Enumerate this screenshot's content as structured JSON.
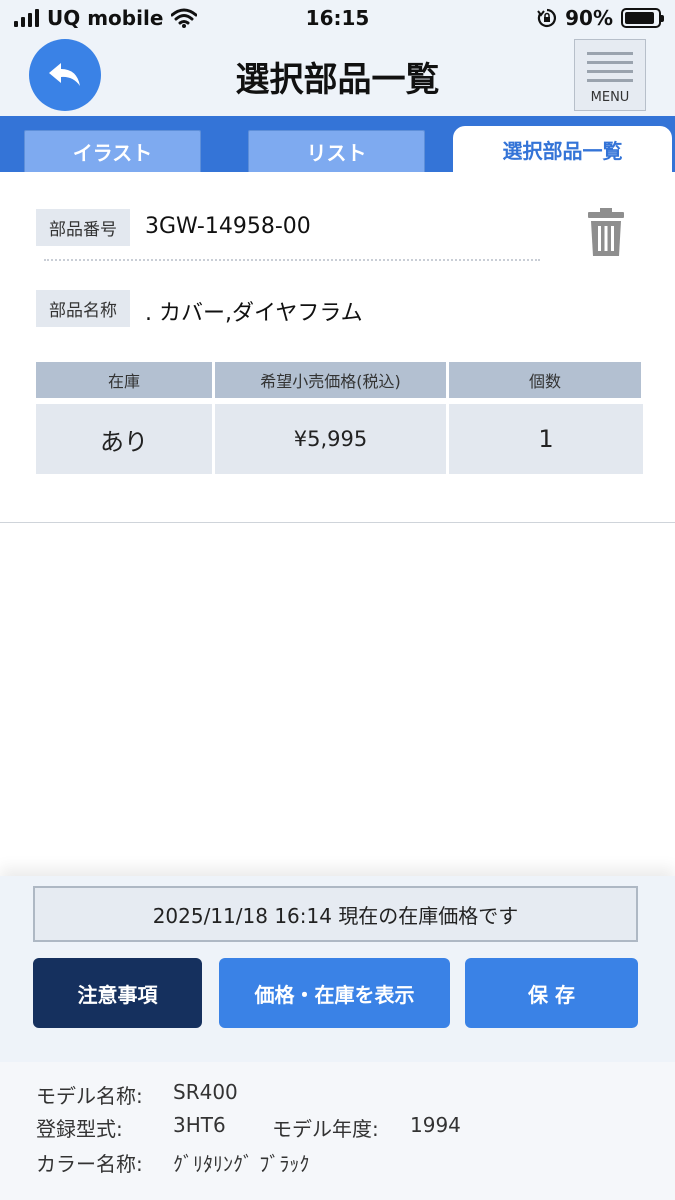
{
  "status_bar": {
    "carrier": "UQ mobile",
    "time": "16:15",
    "battery_percent": "90%",
    "battery_level": 0.9
  },
  "header": {
    "title": "選択部品一覧",
    "menu_label": "MENU"
  },
  "tabs": [
    {
      "label": "イラスト",
      "active": false
    },
    {
      "label": "リスト",
      "active": false
    },
    {
      "label": "選択部品一覧",
      "active": true
    }
  ],
  "part": {
    "number_label": "部品番号",
    "number": "3GW-14958-00",
    "name_label": "部品名称",
    "name": ". カバー,ダイヤフラム"
  },
  "table": {
    "headers": [
      "在庫",
      "希望小売価格(税込)",
      "個数"
    ],
    "row": [
      "あり",
      "¥5,995",
      "1"
    ]
  },
  "bottom": {
    "notice": "2025/11/18 16:14 現在の在庫価格です",
    "caution_label": "注意事項",
    "show_label": "価格・在庫を表示",
    "save_label": "保 存"
  },
  "model": {
    "name_label": "モデル名称:",
    "name": "SR400",
    "type_label": "登録型式:",
    "type": "3HT6",
    "year_label": "モデル年度:",
    "year": "1994",
    "color_label": "カラー名称:",
    "color": "ｸﾞﾘﾀﾘﾝｸﾞ ﾌﾞﾗｯｸ"
  }
}
